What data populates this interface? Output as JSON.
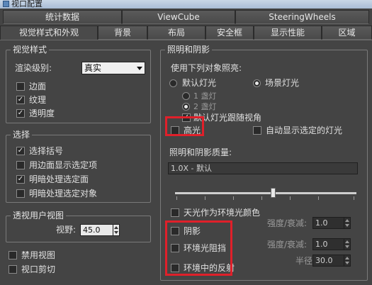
{
  "title": "视口配置",
  "tabs_row1": [
    {
      "label": "统计数据"
    },
    {
      "label": "ViewCube"
    },
    {
      "label": "SteeringWheels"
    }
  ],
  "tabs_row2": [
    {
      "label": "视觉样式和外观",
      "active": true
    },
    {
      "label": "背景"
    },
    {
      "label": "布局"
    },
    {
      "label": "安全框"
    },
    {
      "label": "显示性能"
    },
    {
      "label": "区域"
    }
  ],
  "visual_style": {
    "group_label": "视觉样式",
    "render_level_label": "渲染级别:",
    "render_level_value": "真实",
    "edges_label": "边面",
    "edges_checked": false,
    "texture_label": "纹理",
    "texture_checked": true,
    "transparency_label": "透明度",
    "transparency_checked": true
  },
  "selection": {
    "group_label": "选择",
    "brackets_label": "选择括号",
    "brackets_checked": true,
    "edged_faces_label": "用边面显示选定项",
    "edged_faces_checked": false,
    "shade_faces_label": "明暗处理选定面",
    "shade_faces_checked": true,
    "shade_objects_label": "明暗处理选定对象",
    "shade_objects_checked": false
  },
  "perspective": {
    "group_label": "透视用户视图",
    "fov_label": "视野:",
    "fov_value": "45.0"
  },
  "disable_view_label": "禁用视图",
  "viewport_clip_label": "视口剪切",
  "lighting": {
    "group_label": "照明和阴影",
    "illuminate_label": "使用下列对象照亮:",
    "default_lights_label": "默认灯光",
    "scene_lights_label": "场景灯光",
    "one_light_label": "1 盏灯",
    "two_lights_label": "2 盏灯",
    "follow_camera_label": "默认灯光跟随视角",
    "highlights_label": "高光",
    "auto_display_label": "自动显示选定的灯光",
    "quality_label": "照明和阴影质量:",
    "quality_value": "1.0X - 默认",
    "skylight_label": "天光作为环境光颜色",
    "shadows_label": "阴影",
    "ao_label": "环境光阻挡",
    "reflections_label": "环境中的反射",
    "intensity_label": "强度/衰减:",
    "intensity1_value": "1.0",
    "intensity2_value": "1.0",
    "radius_label": "半径:",
    "radius_value": "30.0"
  }
}
